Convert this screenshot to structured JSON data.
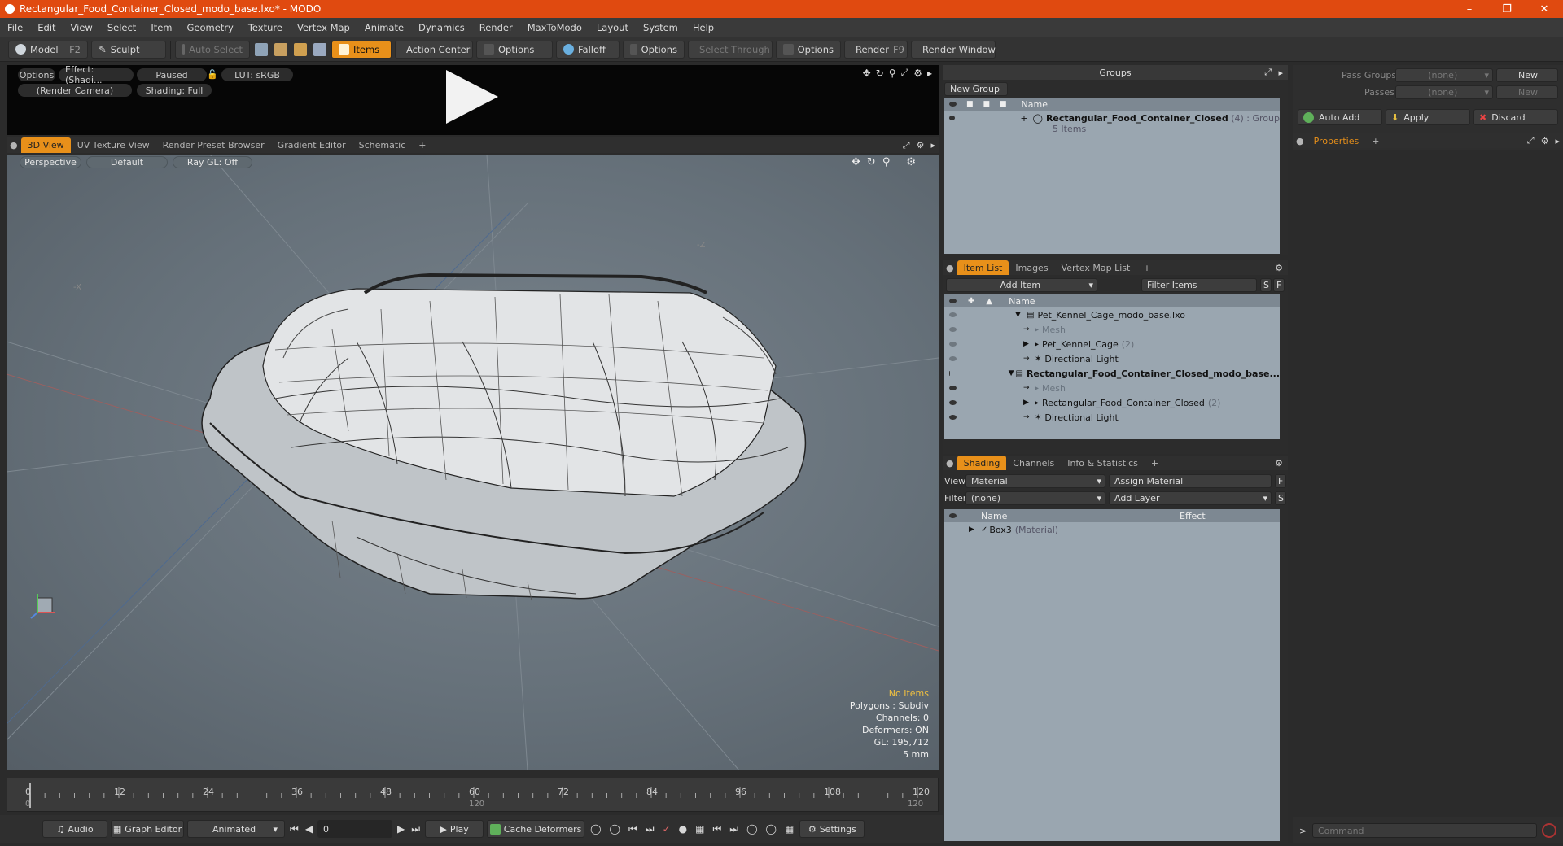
{
  "window": {
    "title": "Rectangular_Food_Container_Closed_modo_base.lxo* - MODO"
  },
  "menu": [
    "File",
    "Edit",
    "View",
    "Select",
    "Item",
    "Geometry",
    "Texture",
    "Vertex Map",
    "Animate",
    "Dynamics",
    "Render",
    "MaxToModo",
    "Layout",
    "System",
    "Help"
  ],
  "toolbar": {
    "model": "Model",
    "model_key": "F2",
    "sculpt": "Sculpt",
    "auto_select": "Auto Select",
    "items": "Items",
    "action_center": "Action Center",
    "options1": "Options",
    "falloff": "Falloff",
    "options2": "Options",
    "select_through": "Select Through",
    "options3": "Options",
    "render": "Render",
    "render_key": "F9",
    "render_window": "Render Window"
  },
  "preview": {
    "options": "Options",
    "effect": "Effect: (Shadi...",
    "paused": "Paused",
    "lut": "LUT: sRGB",
    "camera": "(Render Camera)",
    "shading": "Shading: Full"
  },
  "viewport_tabs": [
    "3D View",
    "UV Texture View",
    "Render Preset Browser",
    "Gradient Editor",
    "Schematic",
    "+"
  ],
  "viewport": {
    "projection": "Perspective",
    "style": "Default",
    "raygl": "Ray GL: Off",
    "axis_x": "-X",
    "axis_z": "-Z"
  },
  "info": {
    "no_items": "No Items",
    "polygons": "Polygons : Subdiv",
    "channels": "Channels: 0",
    "deformers": "Deformers: ON",
    "gl": "GL: 195,712",
    "unit": "5 mm"
  },
  "timeline": {
    "ticks": [
      "0",
      "12",
      "24",
      "36",
      "48",
      "60",
      "72",
      "84",
      "96",
      "108",
      "120"
    ],
    "sub_ticks": [
      "0",
      "120",
      "120"
    ]
  },
  "transport": {
    "audio": "Audio",
    "graph_editor": "Graph Editor",
    "animated": "Animated",
    "frame": "0",
    "play": "Play",
    "cache": "Cache Deformers",
    "settings": "Settings"
  },
  "groups": {
    "title": "Groups",
    "new_group": "New Group",
    "col_name": "Name",
    "item_name": "Rectangular_Food_Container_Closed",
    "item_count": "(4)",
    "item_type": ": Group",
    "item_sub": "5 Items"
  },
  "item_tabs": [
    "Item List",
    "Images",
    "Vertex Map List",
    "+"
  ],
  "item_list": {
    "add_item": "Add Item",
    "filter": "Filter Items",
    "s": "S",
    "f": "F",
    "col_name": "Name",
    "rows": [
      {
        "label": "Pet_Kennel_Cage_modo_base.lxo",
        "count": "",
        "indent": 0,
        "bold": false,
        "muted": false,
        "arrow": "▼"
      },
      {
        "label": "Mesh",
        "count": "",
        "indent": 1,
        "bold": false,
        "muted": true,
        "arrow": ""
      },
      {
        "label": "Pet_Kennel_Cage",
        "count": "(2)",
        "indent": 1,
        "bold": false,
        "muted": false,
        "arrow": "▶"
      },
      {
        "label": "Directional Light",
        "count": "",
        "indent": 1,
        "bold": false,
        "muted": false,
        "arrow": ""
      },
      {
        "label": "Rectangular_Food_Container_Closed_modo_base...",
        "count": "",
        "indent": 0,
        "bold": true,
        "muted": false,
        "arrow": "▼"
      },
      {
        "label": "Mesh",
        "count": "",
        "indent": 1,
        "bold": false,
        "muted": true,
        "arrow": ""
      },
      {
        "label": "Rectangular_Food_Container_Closed",
        "count": "(2)",
        "indent": 1,
        "bold": false,
        "muted": false,
        "arrow": "▶"
      },
      {
        "label": "Directional Light",
        "count": "",
        "indent": 1,
        "bold": false,
        "muted": false,
        "arrow": ""
      }
    ]
  },
  "shading_tabs": [
    "Shading",
    "Channels",
    "Info & Statistics",
    "+"
  ],
  "shading": {
    "view_label": "View",
    "view_value": "Material",
    "assign": "Assign Material",
    "f": "F",
    "filter_label": "Filter",
    "filter_value": "(none)",
    "add_layer": "Add Layer",
    "s": "S",
    "col_name": "Name",
    "col_effect": "Effect",
    "row_name": "Box3",
    "row_type": "(Material)"
  },
  "pass": {
    "pass_groups": "Pass Groups",
    "pass_groups_val": "(none)",
    "new": "New",
    "passes": "Passes",
    "passes_val": "(none)",
    "new2": "New"
  },
  "actions": {
    "auto_add": "Auto Add",
    "apply": "Apply",
    "discard": "Discard"
  },
  "properties": {
    "tab": "Properties",
    "plus": "+"
  },
  "command": {
    "placeholder": "Command"
  }
}
